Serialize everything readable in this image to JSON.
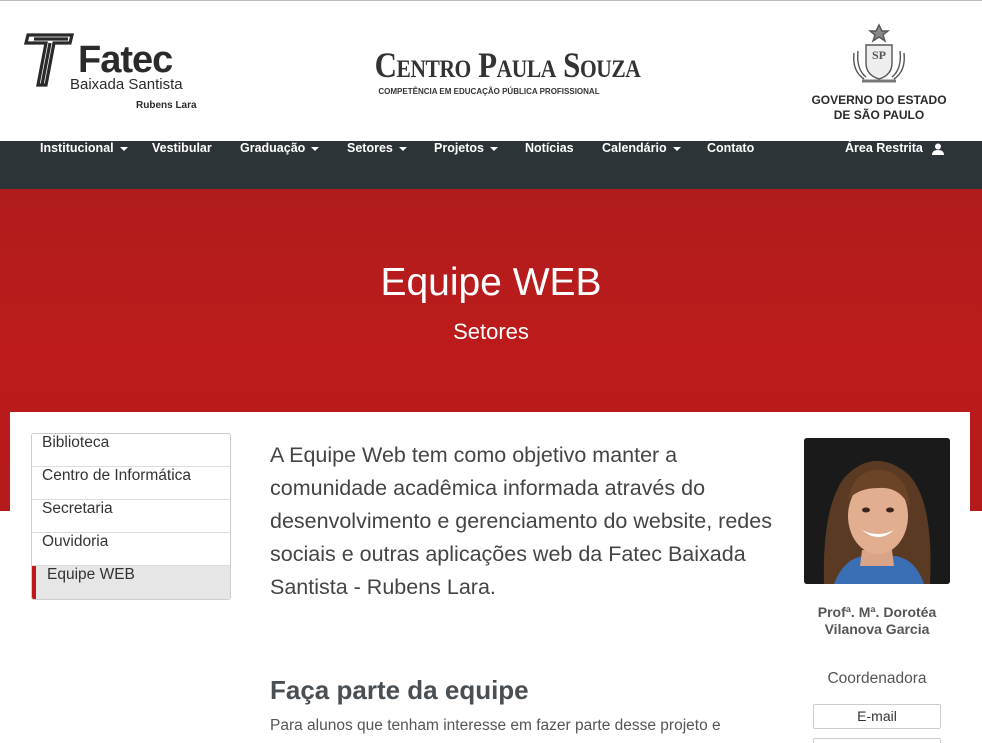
{
  "header": {
    "fatec": {
      "name": "Fatec",
      "campus": "Baixada Santista",
      "subtitle": "Rubens Lara"
    },
    "cps": {
      "title": "Centro Paula Souza",
      "tagline": "COMPETÊNCIA EM EDUCAÇÃO PÚBLICA PROFISSIONAL"
    },
    "gov": {
      "text": "GOVERNO DO ESTADO\nDE SÃO PAULO",
      "seal_letters": "SP"
    }
  },
  "nav": {
    "items": [
      {
        "label": "Institucional",
        "dropdown": true
      },
      {
        "label": "Vestibular",
        "dropdown": false
      },
      {
        "label": "Graduação",
        "dropdown": true
      },
      {
        "label": "Setores",
        "dropdown": true
      },
      {
        "label": "Projetos",
        "dropdown": true
      },
      {
        "label": "Notícias",
        "dropdown": false
      },
      {
        "label": "Calendário",
        "dropdown": true
      },
      {
        "label": "Contato",
        "dropdown": false
      }
    ],
    "restricted": "Área Restrita"
  },
  "hero": {
    "title": "Equipe WEB",
    "subtitle": "Setores"
  },
  "sidebar": {
    "items": [
      {
        "label": "Biblioteca",
        "active": false
      },
      {
        "label": "Centro de Informática",
        "active": false
      },
      {
        "label": "Secretaria",
        "active": false
      },
      {
        "label": "Ouvidoria",
        "active": false
      },
      {
        "label": "Equipe WEB",
        "active": true
      }
    ]
  },
  "main": {
    "intro": "A Equipe Web tem como objetivo manter a comunidade acadêmica informada através do desenvolvimento e gerenciamento do website, redes sociais e outras aplicações web da Fatec Baixada Santista - Rubens Lara.",
    "section_title": "Faça parte da equipe",
    "section_text": "Para alunos que tenham interesse em fazer parte desse projeto e"
  },
  "person": {
    "name": "Profª. Mª. Dorotéa Vilanova Garcia",
    "role": "Coordenadora",
    "email_label": "E-mail"
  },
  "colors": {
    "nav_bg": "#2c3438",
    "hero_bg": "#b51a1a",
    "accent": "#c0161b"
  }
}
